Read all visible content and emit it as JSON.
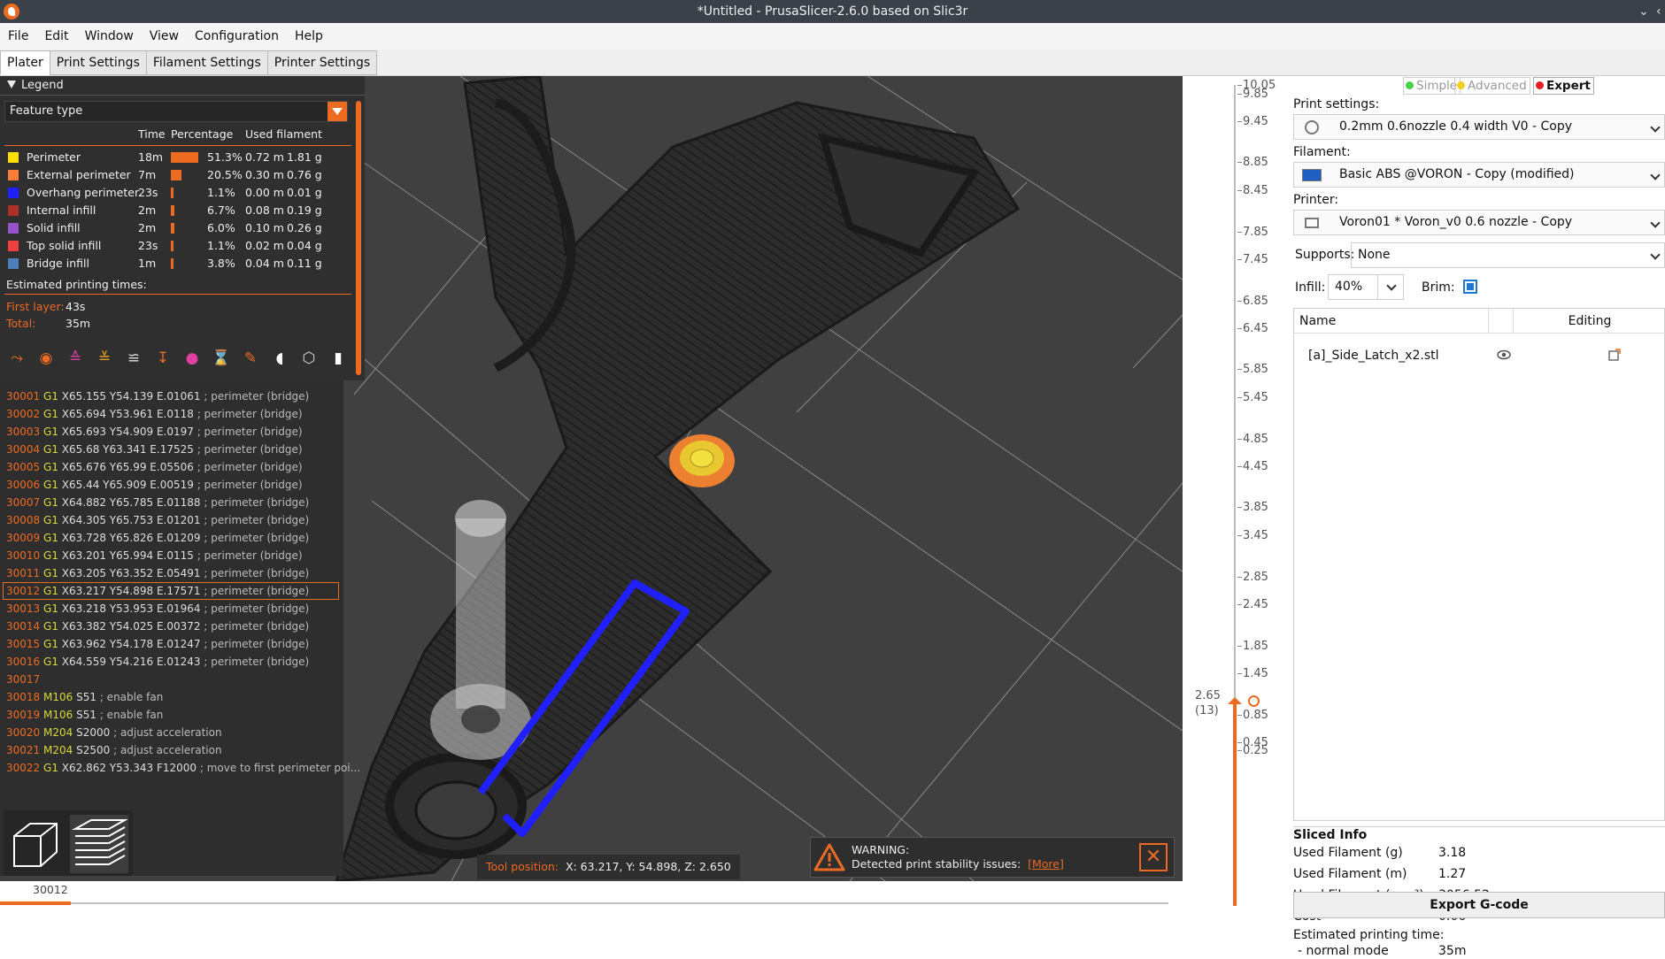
{
  "window": {
    "title": "*Untitled - PrusaSlicer-2.6.0 based on Slic3r"
  },
  "menu": [
    "File",
    "Edit",
    "Window",
    "View",
    "Configuration",
    "Help"
  ],
  "tabs": [
    "Plater",
    "Print Settings",
    "Filament Settings",
    "Printer Settings"
  ],
  "legend": {
    "title": "Legend",
    "view_type": "Feature type",
    "columns": [
      "Time",
      "Percentage",
      "Used filament"
    ],
    "features": [
      {
        "name": "Perimeter",
        "color": "#ffe000",
        "time": "18m",
        "pct": "51.3%",
        "pct_value": 0.513,
        "len": "0.72 m",
        "wt": "1.81 g"
      },
      {
        "name": "External perimeter",
        "color": "#ff7d38",
        "time": "7m",
        "pct": "20.5%",
        "pct_value": 0.205,
        "len": "0.30 m",
        "wt": "0.76 g"
      },
      {
        "name": "Overhang perimeter",
        "color": "#1f1fff",
        "time": "23s",
        "pct": "1.1%",
        "pct_value": 0.011,
        "len": "0.00 m",
        "wt": "0.01 g"
      },
      {
        "name": "Internal infill",
        "color": "#b03029",
        "time": "2m",
        "pct": "6.7%",
        "pct_value": 0.067,
        "len": "0.08 m",
        "wt": "0.19 g"
      },
      {
        "name": "Solid infill",
        "color": "#9654cc",
        "time": "2m",
        "pct": "6.0%",
        "pct_value": 0.06,
        "len": "0.10 m",
        "wt": "0.26 g"
      },
      {
        "name": "Top solid infill",
        "color": "#f04040",
        "time": "23s",
        "pct": "1.1%",
        "pct_value": 0.011,
        "len": "0.02 m",
        "wt": "0.04 g"
      },
      {
        "name": "Bridge infill",
        "color": "#4d80ba",
        "time": "1m",
        "pct": "3.8%",
        "pct_value": 0.038,
        "len": "0.04 m",
        "wt": "0.11 g"
      }
    ],
    "est_label": "Estimated printing times:",
    "first_layer_label": "First layer:",
    "first_layer": "43s",
    "total_label": "Total:",
    "total": "35m"
  },
  "gcode": [
    {
      "n": "30001",
      "cmd": "G1",
      "args": "X65.155 Y54.139 E.01061",
      "comment": "; perimeter (bridge)"
    },
    {
      "n": "30002",
      "cmd": "G1",
      "args": "X65.694 Y53.961 E.0118",
      "comment": "; perimeter (bridge)"
    },
    {
      "n": "30003",
      "cmd": "G1",
      "args": "X65.693 Y54.909 E.0197",
      "comment": "; perimeter (bridge)"
    },
    {
      "n": "30004",
      "cmd": "G1",
      "args": "X65.68 Y63.341 E.17525",
      "comment": "; perimeter (bridge)"
    },
    {
      "n": "30005",
      "cmd": "G1",
      "args": "X65.676 Y65.99 E.05506",
      "comment": "; perimeter (bridge)"
    },
    {
      "n": "30006",
      "cmd": "G1",
      "args": "X65.44 Y65.909 E.00519",
      "comment": "; perimeter (bridge)"
    },
    {
      "n": "30007",
      "cmd": "G1",
      "args": "X64.882 Y65.785 E.01188",
      "comment": "; perimeter (bridge)"
    },
    {
      "n": "30008",
      "cmd": "G1",
      "args": "X64.305 Y65.753 E.01201",
      "comment": "; perimeter (bridge)"
    },
    {
      "n": "30009",
      "cmd": "G1",
      "args": "X63.728 Y65.826 E.01209",
      "comment": "; perimeter (bridge)"
    },
    {
      "n": "30010",
      "cmd": "G1",
      "args": "X63.201 Y65.994 E.0115",
      "comment": "; perimeter (bridge)"
    },
    {
      "n": "30011",
      "cmd": "G1",
      "args": "X63.205 Y63.352 E.05491",
      "comment": "; perimeter (bridge)"
    },
    {
      "n": "30012",
      "cmd": "G1",
      "args": "X63.217 Y54.898 E.17571",
      "comment": "; perimeter (bridge)",
      "selected": true
    },
    {
      "n": "30013",
      "cmd": "G1",
      "args": "X63.218 Y53.953 E.01964",
      "comment": "; perimeter (bridge)"
    },
    {
      "n": "30014",
      "cmd": "G1",
      "args": "X63.382 Y54.025 E.00372",
      "comment": "; perimeter (bridge)"
    },
    {
      "n": "30015",
      "cmd": "G1",
      "args": "X63.962 Y54.178 E.01247",
      "comment": "; perimeter (bridge)"
    },
    {
      "n": "30016",
      "cmd": "G1",
      "args": "X64.559 Y54.216 E.01243",
      "comment": "; perimeter (bridge)"
    },
    {
      "n": "30017",
      "cmd": "",
      "args": "",
      "comment": ""
    },
    {
      "n": "30018",
      "cmd": "M106",
      "args": "S51",
      "comment": "; enable fan"
    },
    {
      "n": "30019",
      "cmd": "M106",
      "args": "S51",
      "comment": "; enable fan"
    },
    {
      "n": "30020",
      "cmd": "M204",
      "args": "S2000",
      "comment": "; adjust acceleration"
    },
    {
      "n": "30021",
      "cmd": "M204",
      "args": "S2500",
      "comment": "; adjust acceleration"
    },
    {
      "n": "30022",
      "cmd": "G1",
      "args": "X62.862 Y53.343 F12000",
      "comment": "; move to first perimeter poi..."
    }
  ],
  "toolpos": {
    "label": "Tool position:",
    "value": "X: 63.217, Y: 54.898, Z: 2.650"
  },
  "warning": {
    "title": "WARNING:",
    "text": "Detected print stability issues:",
    "more": "[More]"
  },
  "hslider": {
    "value": "30012"
  },
  "vslider": {
    "ticks": [
      "10.05",
      "9.85",
      "9.45",
      "8.85",
      "8.45",
      "7.85",
      "7.45",
      "6.85",
      "6.45",
      "5.85",
      "5.45",
      "4.85",
      "4.45",
      "3.85",
      "3.45",
      "2.85",
      "2.45",
      "1.85",
      "1.45",
      "0.85",
      "0.45",
      "0.25"
    ],
    "current": "2.65",
    "current_layer": "(13)"
  },
  "sidebar": {
    "modes": [
      "Simple",
      "Advanced",
      "Expert"
    ],
    "print_label": "Print settings:",
    "print_value": "0.2mm 0.6nozzle 0.4 width V0 - Copy",
    "filament_label": "Filament:",
    "filament_value": "Basic ABS @VORON - Copy (modified)",
    "printer_label": "Printer:",
    "printer_value": "Voron01 * Voron_v0 0.6 nozzle - Copy",
    "supports_label": "Supports:",
    "supports_value": "None",
    "infill_label": "Infill:",
    "infill_value": "40%",
    "brim_label": "Brim:",
    "list_name": "Name",
    "list_editing": "Editing",
    "object": "[a]_Side_Latch_x2.stl",
    "sliced_title": "Sliced Info",
    "sliced": [
      {
        "k": "Used Filament (g)",
        "v": "3.18"
      },
      {
        "k": "Used Filament (m)",
        "v": "1.27"
      },
      {
        "k": "Used Filament (mm³)",
        "v": "3056.52"
      },
      {
        "k": "Cost",
        "v": "0.06"
      }
    ],
    "est_label": "Estimated printing time:",
    "mode_label": "- normal mode",
    "mode_time": "35m",
    "export": "Export G-code"
  }
}
